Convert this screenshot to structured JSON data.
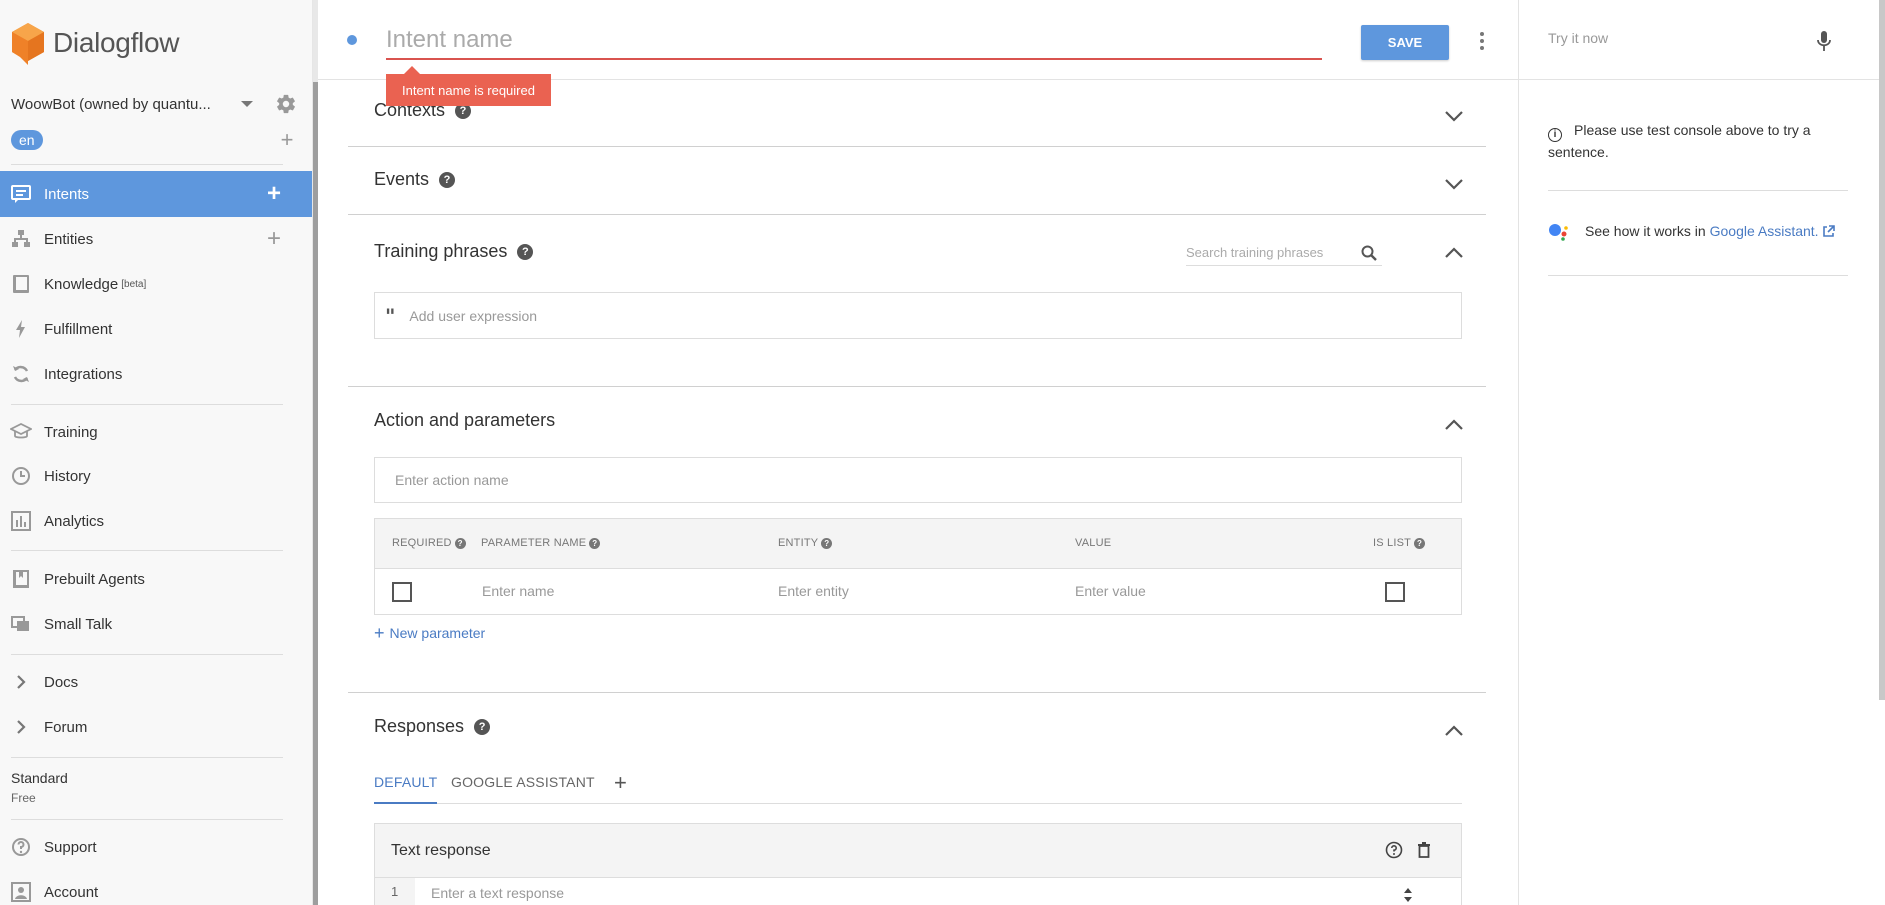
{
  "app": {
    "logo_text": "Dialogflow",
    "accent_color": "#5e97dd",
    "error_color": "#ea6251"
  },
  "sidebar": {
    "agent_name": "WoowBot (owned by quantu...",
    "language": "en",
    "nav": [
      {
        "label": "Intents",
        "icon": "chat-icon",
        "active": true,
        "plus": "+"
      },
      {
        "label": "Entities",
        "icon": "hierarchy-icon",
        "plus": "+"
      },
      {
        "label": "Knowledge",
        "icon": "book-icon",
        "sup": "[beta]"
      },
      {
        "label": "Fulfillment",
        "icon": "lightning-icon"
      },
      {
        "label": "Integrations",
        "icon": "sync-icon"
      },
      {
        "label": "Training",
        "icon": "graduation-cap-icon"
      },
      {
        "label": "History",
        "icon": "clock-icon"
      },
      {
        "label": "Analytics",
        "icon": "bar-chart-icon"
      },
      {
        "label": "Prebuilt Agents",
        "icon": "bookmark-icon"
      },
      {
        "label": "Small Talk",
        "icon": "chat-bubbles-icon"
      },
      {
        "label": "Docs",
        "icon": "chevron-right-icon"
      },
      {
        "label": "Forum",
        "icon": "chevron-right-icon"
      },
      {
        "label": "Support",
        "icon": "question-circle-icon"
      },
      {
        "label": "Account",
        "icon": "account-icon"
      }
    ],
    "plan": {
      "title": "Standard",
      "subtitle": "Free"
    }
  },
  "editor": {
    "intent_name_placeholder": "Intent name",
    "save_label": "SAVE",
    "error_message": "Intent name is required",
    "sections": {
      "contexts": "Contexts",
      "events": "Events",
      "training": "Training phrases",
      "action": "Action and parameters",
      "responses": "Responses"
    },
    "training_search_placeholder": "Search training phrases",
    "add_expression_placeholder": "Add user expression",
    "action_placeholder": "Enter action name",
    "param_table": {
      "headers": {
        "required": "REQUIRED",
        "name": "PARAMETER NAME",
        "entity": "ENTITY",
        "value": "VALUE",
        "is_list": "IS LIST"
      },
      "row": {
        "name_placeholder": "Enter name",
        "entity_placeholder": "Enter entity",
        "value_placeholder": "Enter value"
      }
    },
    "new_parameter": "New parameter",
    "response_tabs": [
      "DEFAULT",
      "GOOGLE ASSISTANT"
    ],
    "text_response": {
      "title": "Text response",
      "row_number": "1",
      "placeholder": "Enter a text response"
    }
  },
  "console": {
    "try_placeholder": "Try it now",
    "info_text": "Please use test console above to try a sentence.",
    "ga_text": "See how it works in",
    "ga_link": "Google Assistant."
  }
}
